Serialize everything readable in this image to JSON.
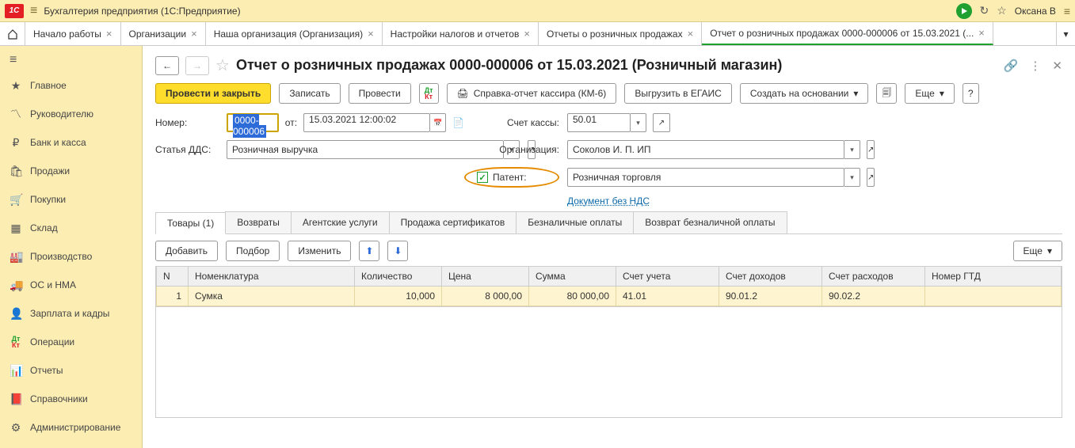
{
  "app": {
    "title": "Бухгалтерия предприятия (1С:Предприятие)",
    "user": "Оксана В"
  },
  "tabs": [
    {
      "label": "Начало работы"
    },
    {
      "label": "Организации"
    },
    {
      "label": "Наша организация (Организация)"
    },
    {
      "label": "Настройки налогов и отчетов"
    },
    {
      "label": "Отчеты о розничных продажах"
    },
    {
      "label": "Отчет о розничных продажах 0000-000006 от 15.03.2021 (...",
      "active": true
    }
  ],
  "sidebar": [
    {
      "icon": "menu",
      "label": ""
    },
    {
      "icon": "star",
      "label": "Главное"
    },
    {
      "icon": "chart",
      "label": "Руководителю"
    },
    {
      "icon": "ruble",
      "label": "Банк и касса"
    },
    {
      "icon": "bag",
      "label": "Продажи"
    },
    {
      "icon": "cart",
      "label": "Покупки"
    },
    {
      "icon": "boxes",
      "label": "Склад"
    },
    {
      "icon": "factory",
      "label": "Производство"
    },
    {
      "icon": "truck",
      "label": "ОС и НМА"
    },
    {
      "icon": "person",
      "label": "Зарплата и кадры"
    },
    {
      "icon": "dtkt",
      "label": "Операции"
    },
    {
      "icon": "bars",
      "label": "Отчеты"
    },
    {
      "icon": "book",
      "label": "Справочники"
    },
    {
      "icon": "gear",
      "label": "Администрирование"
    }
  ],
  "page": {
    "title": "Отчет о розничных продажах 0000-000006 от 15.03.2021 (Розничный магазин)"
  },
  "toolbar": {
    "post_close": "Провести и закрыть",
    "write": "Записать",
    "post": "Провести",
    "km6": "Справка-отчет кассира (КМ-6)",
    "egais": "Выгрузить в ЕГАИС",
    "create_based": "Создать на основании",
    "more": "Еще",
    "help": "?"
  },
  "form": {
    "number_label": "Номер:",
    "number_value": "0000-000006",
    "from_label": "от:",
    "date_value": "15.03.2021 12:00:02",
    "account_label": "Счет кассы:",
    "account_value": "50.01",
    "dds_label": "Статья ДДС:",
    "dds_value": "Розничная выручка",
    "org_label": "Организация:",
    "org_value": "Соколов И. П. ИП",
    "patent_label": "Патент:",
    "patent_value": "Розничная торговля",
    "vat_link": "Документ без НДС"
  },
  "doc_tabs": [
    "Товары (1)",
    "Возвраты",
    "Агентские услуги",
    "Продажа сертификатов",
    "Безналичные оплаты",
    "Возврат безналичной оплаты"
  ],
  "table_toolbar": {
    "add": "Добавить",
    "pick": "Подбор",
    "change": "Изменить",
    "more": "Еще"
  },
  "table": {
    "headers": [
      "N",
      "Номенклатура",
      "Количество",
      "Цена",
      "Сумма",
      "Счет учета",
      "Счет доходов",
      "Счет расходов",
      "Номер ГТД"
    ],
    "rows": [
      {
        "n": "1",
        "name": "Сумка",
        "qty": "10,000",
        "price": "8 000,00",
        "sum": "80 000,00",
        "acc": "41.01",
        "inc": "90.01.2",
        "exp": "90.02.2",
        "gtd": ""
      }
    ]
  }
}
